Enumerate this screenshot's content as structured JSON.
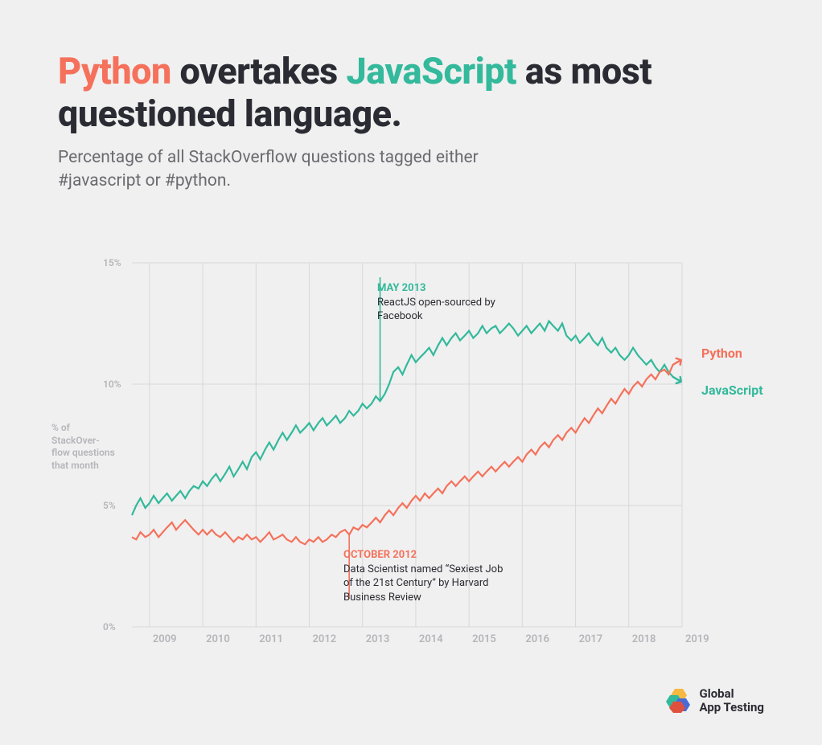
{
  "title": {
    "python": "Python",
    "mid1": " overtakes ",
    "js": "JavaScript",
    "mid2": " as most questioned language."
  },
  "subtitle": "Percentage of all StackOverflow questions tagged either #javascript or #python.",
  "ylabel": "% of StackOver-flow questions that month",
  "yticks": [
    "0%",
    "5%",
    "10%",
    "15%"
  ],
  "xticks": [
    "2009",
    "2010",
    "2011",
    "2012",
    "2013",
    "2014",
    "2015",
    "2016",
    "2017",
    "2018",
    "2019"
  ],
  "series_labels": {
    "python": "Python",
    "javascript": "JavaScript"
  },
  "annotations": {
    "may2013": {
      "date": "MAY 2013",
      "desc": "ReactJS open-sourced by Facebook"
    },
    "oct2012": {
      "date": "OCTOBER 2012",
      "desc": "Data Scientist named “Sexiest Job of the 21st Century” by Harvard Business Review"
    }
  },
  "brand": {
    "line1": "Global",
    "line2": "App Testing"
  },
  "colors": {
    "python": "#f5715b",
    "javascript": "#33b99b",
    "grid": "#d8d8db",
    "tick": "#b5b5ba"
  },
  "chart_data": {
    "type": "line",
    "xlabel": "",
    "ylabel": "% of StackOverflow questions that month",
    "ylim": [
      0,
      15
    ],
    "xlim": [
      2008.67,
      2019
    ],
    "series": [
      {
        "name": "JavaScript",
        "color": "#33b99b",
        "x": [
          2008.67,
          2008.75,
          2008.83,
          2008.92,
          2009,
          2009.08,
          2009.17,
          2009.25,
          2009.33,
          2009.42,
          2009.5,
          2009.58,
          2009.67,
          2009.75,
          2009.83,
          2009.92,
          2010,
          2010.08,
          2010.17,
          2010.25,
          2010.33,
          2010.42,
          2010.5,
          2010.58,
          2010.67,
          2010.75,
          2010.83,
          2010.92,
          2011,
          2011.08,
          2011.17,
          2011.25,
          2011.33,
          2011.42,
          2011.5,
          2011.58,
          2011.67,
          2011.75,
          2011.83,
          2011.92,
          2012,
          2012.08,
          2012.17,
          2012.25,
          2012.33,
          2012.42,
          2012.5,
          2012.58,
          2012.67,
          2012.75,
          2012.83,
          2012.92,
          2013,
          2013.08,
          2013.17,
          2013.25,
          2013.33,
          2013.42,
          2013.5,
          2013.58,
          2013.67,
          2013.75,
          2013.83,
          2013.92,
          2014,
          2014.08,
          2014.17,
          2014.25,
          2014.33,
          2014.42,
          2014.5,
          2014.58,
          2014.67,
          2014.75,
          2014.83,
          2014.92,
          2015,
          2015.08,
          2015.17,
          2015.25,
          2015.33,
          2015.42,
          2015.5,
          2015.58,
          2015.67,
          2015.75,
          2015.83,
          2015.92,
          2016,
          2016.08,
          2016.17,
          2016.25,
          2016.33,
          2016.42,
          2016.5,
          2016.58,
          2016.67,
          2016.75,
          2016.83,
          2016.92,
          2017,
          2017.08,
          2017.17,
          2017.25,
          2017.33,
          2017.42,
          2017.5,
          2017.58,
          2017.67,
          2017.75,
          2017.83,
          2017.92,
          2018,
          2018.08,
          2018.17,
          2018.25,
          2018.33,
          2018.42,
          2018.5,
          2018.58,
          2018.67,
          2018.75,
          2018.83
        ],
        "values": [
          4.6,
          5.0,
          5.3,
          4.9,
          5.1,
          5.4,
          5.1,
          5.3,
          5.5,
          5.2,
          5.4,
          5.6,
          5.3,
          5.6,
          5.8,
          5.7,
          6.0,
          5.8,
          6.1,
          6.3,
          6.0,
          6.3,
          6.6,
          6.2,
          6.5,
          6.8,
          6.5,
          7.0,
          7.2,
          6.9,
          7.3,
          7.6,
          7.3,
          7.7,
          8.0,
          7.7,
          8.0,
          8.3,
          8.0,
          8.2,
          8.4,
          8.1,
          8.4,
          8.6,
          8.3,
          8.5,
          8.7,
          8.4,
          8.6,
          8.9,
          8.7,
          8.9,
          9.2,
          9.0,
          9.2,
          9.5,
          9.3,
          9.6,
          10.0,
          10.5,
          10.7,
          10.4,
          10.8,
          11.2,
          10.9,
          11.1,
          11.3,
          11.5,
          11.2,
          11.6,
          11.9,
          11.6,
          11.9,
          12.1,
          11.8,
          12.0,
          12.2,
          11.9,
          12.1,
          12.4,
          12.1,
          12.3,
          12.4,
          12.1,
          12.3,
          12.5,
          12.3,
          12.0,
          12.2,
          12.4,
          12.1,
          12.3,
          12.5,
          12.2,
          12.6,
          12.4,
          12.2,
          12.5,
          12.0,
          11.8,
          12.0,
          11.7,
          11.9,
          12.1,
          11.8,
          11.6,
          11.9,
          11.5,
          11.3,
          11.5,
          11.2,
          11.0,
          11.2,
          11.5,
          11.2,
          11.0,
          10.8,
          11.0,
          10.7,
          10.5,
          10.8,
          10.5,
          10.3
        ]
      },
      {
        "name": "Python",
        "color": "#f5715b",
        "x": [
          2008.67,
          2008.75,
          2008.83,
          2008.92,
          2009,
          2009.08,
          2009.17,
          2009.25,
          2009.33,
          2009.42,
          2009.5,
          2009.58,
          2009.67,
          2009.75,
          2009.83,
          2009.92,
          2010,
          2010.08,
          2010.17,
          2010.25,
          2010.33,
          2010.42,
          2010.5,
          2010.58,
          2010.67,
          2010.75,
          2010.83,
          2010.92,
          2011,
          2011.08,
          2011.17,
          2011.25,
          2011.33,
          2011.42,
          2011.5,
          2011.58,
          2011.67,
          2011.75,
          2011.83,
          2011.92,
          2012,
          2012.08,
          2012.17,
          2012.25,
          2012.33,
          2012.42,
          2012.5,
          2012.58,
          2012.67,
          2012.75,
          2012.83,
          2012.92,
          2013,
          2013.08,
          2013.17,
          2013.25,
          2013.33,
          2013.42,
          2013.5,
          2013.58,
          2013.67,
          2013.75,
          2013.83,
          2013.92,
          2014,
          2014.08,
          2014.17,
          2014.25,
          2014.33,
          2014.42,
          2014.5,
          2014.58,
          2014.67,
          2014.75,
          2014.83,
          2014.92,
          2015,
          2015.08,
          2015.17,
          2015.25,
          2015.33,
          2015.42,
          2015.5,
          2015.58,
          2015.67,
          2015.75,
          2015.83,
          2015.92,
          2016,
          2016.08,
          2016.17,
          2016.25,
          2016.33,
          2016.42,
          2016.5,
          2016.58,
          2016.67,
          2016.75,
          2016.83,
          2016.92,
          2017,
          2017.08,
          2017.17,
          2017.25,
          2017.33,
          2017.42,
          2017.5,
          2017.58,
          2017.67,
          2017.75,
          2017.83,
          2017.92,
          2018,
          2018.08,
          2018.17,
          2018.25,
          2018.33,
          2018.42,
          2018.5,
          2018.58,
          2018.67,
          2018.75,
          2018.83
        ],
        "values": [
          3.7,
          3.6,
          3.9,
          3.7,
          3.8,
          4.0,
          3.7,
          3.9,
          4.1,
          4.3,
          4.0,
          4.2,
          4.4,
          4.2,
          4.0,
          3.8,
          4.0,
          3.8,
          4.0,
          3.8,
          3.7,
          3.9,
          3.7,
          3.5,
          3.7,
          3.6,
          3.8,
          3.6,
          3.7,
          3.5,
          3.7,
          3.9,
          3.6,
          3.7,
          3.8,
          3.6,
          3.5,
          3.7,
          3.5,
          3.4,
          3.6,
          3.5,
          3.7,
          3.5,
          3.6,
          3.8,
          3.7,
          3.9,
          4.0,
          3.8,
          4.1,
          4.0,
          4.2,
          4.1,
          4.3,
          4.5,
          4.3,
          4.6,
          4.8,
          4.6,
          4.9,
          5.1,
          4.9,
          5.2,
          5.4,
          5.2,
          5.5,
          5.3,
          5.5,
          5.7,
          5.5,
          5.8,
          6.0,
          5.8,
          6.0,
          6.2,
          6.0,
          6.2,
          6.4,
          6.2,
          6.4,
          6.6,
          6.4,
          6.6,
          6.8,
          6.6,
          6.8,
          7.0,
          6.8,
          7.1,
          7.3,
          7.1,
          7.4,
          7.6,
          7.4,
          7.7,
          7.9,
          7.7,
          8.0,
          8.2,
          8.0,
          8.3,
          8.6,
          8.4,
          8.7,
          9.0,
          8.8,
          9.1,
          9.4,
          9.2,
          9.5,
          9.8,
          9.6,
          9.9,
          10.1,
          9.9,
          10.2,
          10.4,
          10.2,
          10.5,
          10.6,
          10.4,
          10.8
        ]
      }
    ],
    "annotations": [
      {
        "x": 2013.33,
        "label": "MAY 2013",
        "text": "ReactJS open-sourced by Facebook",
        "series": "JavaScript"
      },
      {
        "x": 2012.75,
        "label": "OCTOBER 2012",
        "text": "Data Scientist named \"Sexiest Job of the 21st Century\" by Harvard Business Review",
        "series": "Python"
      }
    ]
  }
}
